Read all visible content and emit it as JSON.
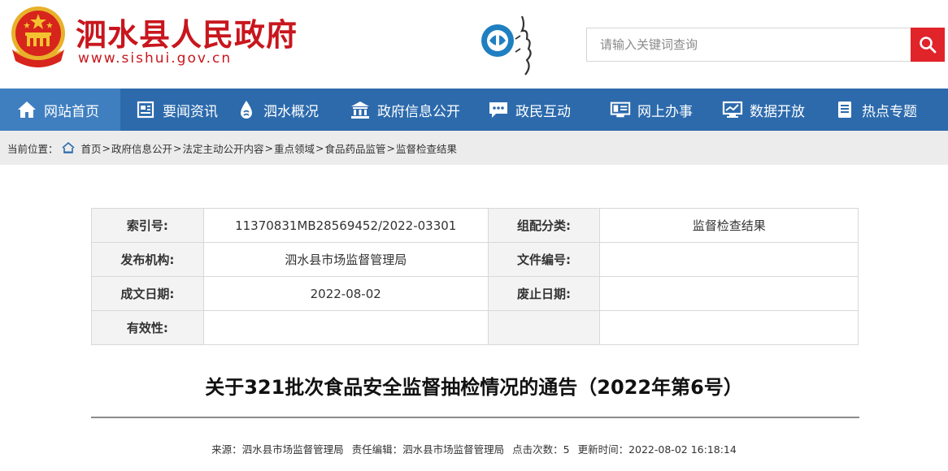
{
  "header": {
    "site_title": "泗水县人民政府",
    "site_url": "www.sishui.gov.cn",
    "emblem_icon": "national-emblem-icon",
    "town_logo_icon": "china-spring-town-logo",
    "brand_color": "#c8161d"
  },
  "search": {
    "placeholder": "请输入关键词查询",
    "button_icon": "search-icon",
    "button_color": "#e0242a"
  },
  "nav": {
    "color": "#2c6aac",
    "items": [
      {
        "label": "网站首页",
        "icon": "home-icon",
        "active": true
      },
      {
        "label": "要闻资讯",
        "icon": "news-icon"
      },
      {
        "label": "泗水概况",
        "icon": "water-drop-icon"
      },
      {
        "label": "政府信息公开",
        "icon": "government-building-icon"
      },
      {
        "label": "政民互动",
        "icon": "chat-icon"
      },
      {
        "label": "网上办事",
        "icon": "computer-service-icon"
      },
      {
        "label": "数据开放",
        "icon": "data-screen-icon"
      },
      {
        "label": "热点专题",
        "icon": "document-list-icon"
      }
    ]
  },
  "breadcrumb": {
    "prefix": "当前位置：",
    "items": [
      "首页",
      "政府信息公开",
      "法定主动公开内容",
      "重点领域",
      "食品药品监管",
      "监督检查结果"
    ],
    "separator": "&gt;"
  },
  "info": {
    "index_label": "索引号:",
    "index_value": "11370831MB28569452/2022-03301",
    "category_label": "组配分类:",
    "category_value": "监督检查结果",
    "publisher_label": "发布机构:",
    "publisher_value": "泗水县市场监督管理局",
    "doc_no_label": "文件编号:",
    "doc_no_value": "",
    "date_label": "成文日期:",
    "date_value": "2022-08-02",
    "expiry_label": "废止日期:",
    "expiry_value": "",
    "validity_label": "有效性:",
    "validity_value": ""
  },
  "article": {
    "title": "关于321批次食品安全监督抽检情况的通告（2022年第6号）",
    "source": "来源：泗水县市场监督管理局",
    "editor": "责任编辑：泗水县市场监督管理局",
    "clicks": "点击次数：5",
    "updated": "更新时间：2022-08-02 16:18:14"
  }
}
